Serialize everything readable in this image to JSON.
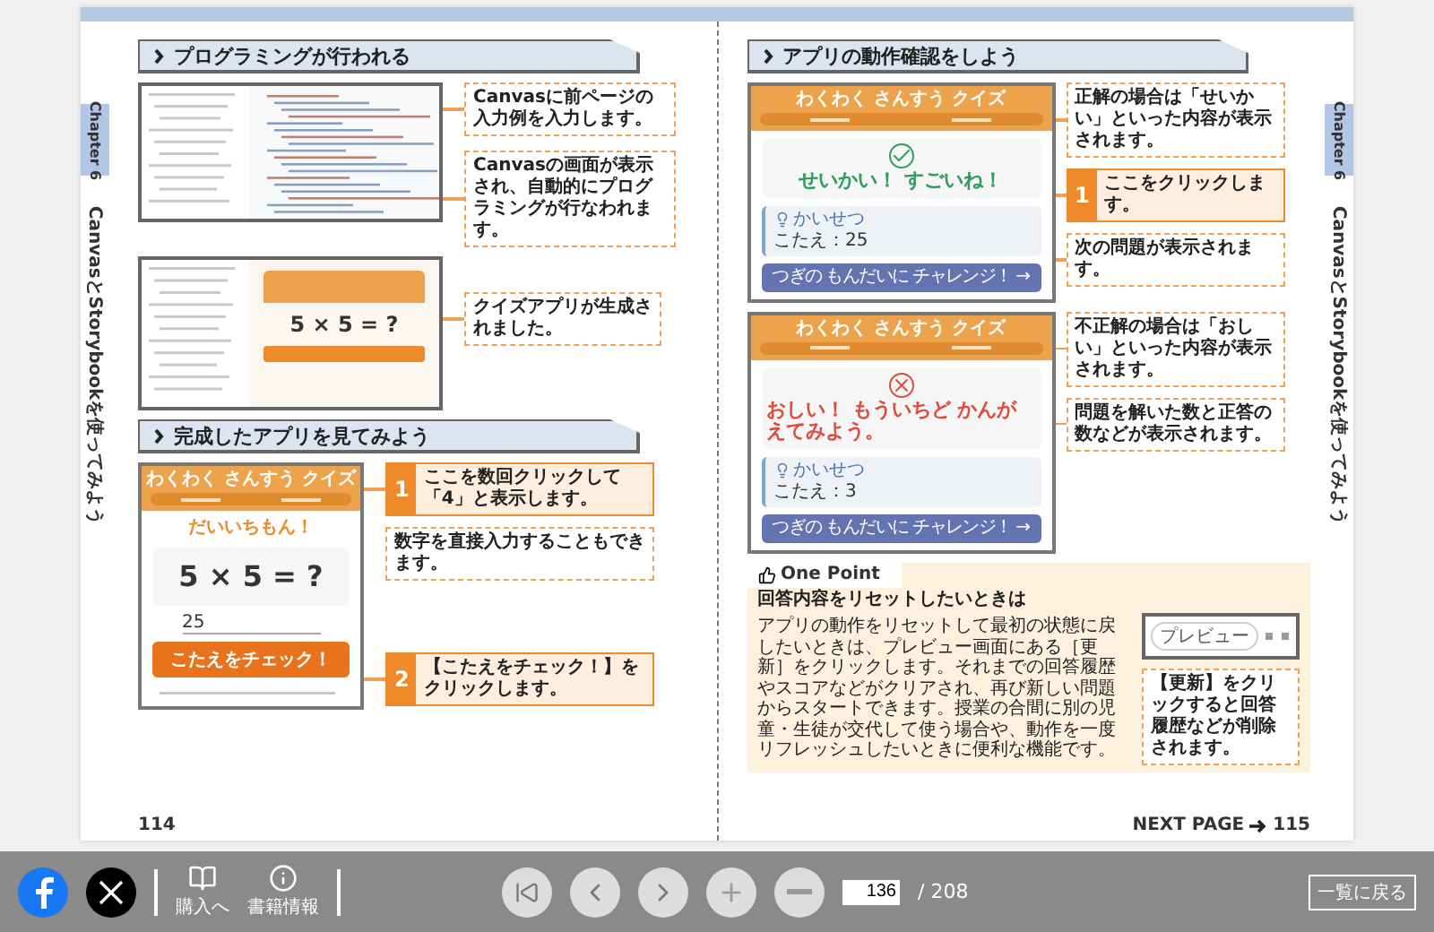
{
  "left_page": {
    "chapter_tab": "Chapter 6",
    "chapter_title": "CanvasとStorybookを使ってみよう",
    "section_1": {
      "heading": "プログラミングが行われる",
      "callouts": [
        "Canvasに前ページの入力例を入力します。",
        "Canvasの画面が表示され、自動的にプログラミングが行なわれます。"
      ],
      "generated_callout": "クイズアプリが生成されました。",
      "quiz_problem": "5 × 5 = ?"
    },
    "section_2": {
      "heading": "完成したアプリを見てみよう",
      "app": {
        "title": "わくわく さんすう クイズ",
        "prompt": "だいいちもん！",
        "problem": "5 × 5 = ?",
        "answer": "25",
        "button": "こたえをチェック！"
      },
      "steps": [
        {
          "number": "1",
          "text": "ここを数回クリックして「4」と表示します。"
        },
        {
          "number": "2",
          "text": "【こたえをチェック！】をクリックします。"
        }
      ],
      "note": "数字を直接入力することもできます。"
    },
    "page_number": "114"
  },
  "right_page": {
    "chapter_tab": "Chapter 6",
    "chapter_title": "CanvasとStorybookを使ってみよう",
    "heading": "アプリの動作確認をしよう",
    "results": [
      {
        "kind": "correct",
        "title": "わくわく さんすう クイズ",
        "message": "せいかい！ すごいね！",
        "hint_label": "かいせつ",
        "answer": "こたえ：25",
        "button": "つぎの もんだいに チャレンジ！ →",
        "callouts": [
          {
            "kind": "note",
            "text": "正解の場合は「せいかい」といった内容が表示されます。"
          },
          {
            "kind": "step",
            "number": "1",
            "text": "ここをクリックします。"
          },
          {
            "kind": "note",
            "text": "次の問題が表示されます。"
          }
        ]
      },
      {
        "kind": "wrong",
        "title": "わくわく さんすう クイズ",
        "message": "おしい！ もういちど かんがえてみよう。",
        "hint_label": "かいせつ",
        "answer": "こたえ：3",
        "button": "つぎの もんだいに チャレンジ！ →",
        "callouts": [
          {
            "kind": "note",
            "text": "不正解の場合は「おしい」といった内容が表示されます。"
          },
          {
            "kind": "note",
            "text": "問題を解いた数と正答の数などが表示されます。"
          }
        ]
      }
    ],
    "one_point": {
      "label": "One Point",
      "title": "回答内容をリセットしたいときは",
      "body": "アプリの動作をリセットして最初の状態に戻したいときは、プレビュー画面にある［更新］をクリックします。それまでの回答履歴やスコアなどがクリアされ、再び新しい問題からスタートできます。授業の合間に別の児童・生徒が交代して使う場合や、動作を一度リフレッシュしたいときに便利な機能です。",
      "preview_tab": "プレビュー",
      "callout": "【更新】をクリックすると回答履歴などが削除されます。"
    },
    "next_page": "NEXT PAGE",
    "page_number": "115"
  },
  "toolbar": {
    "buy_label": "購入へ",
    "info_label": "書籍情報",
    "current_page": "136",
    "total_pages": "/ 208",
    "back_button": "一覧に戻る"
  }
}
